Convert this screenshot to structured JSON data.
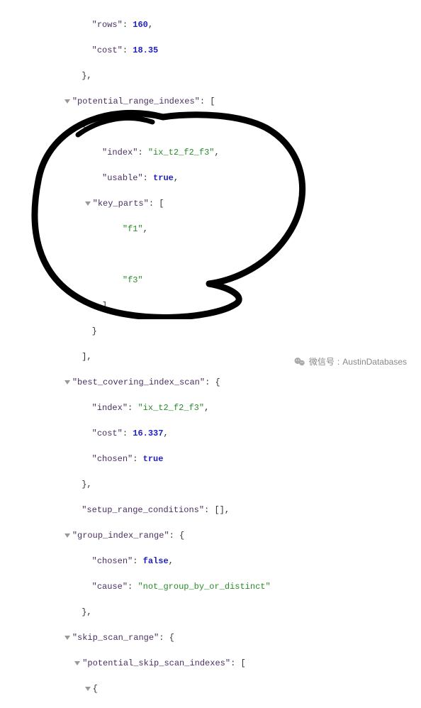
{
  "lines": {
    "rows_key": "\"rows\"",
    "rows_val": "160",
    "cost_key": "\"cost\"",
    "cost_val": "18.35",
    "pri_key": "\"potential_range_indexes\"",
    "index_key": "\"index\"",
    "index_val": "\"ix_t2_f2_f3\"",
    "usable_key": "\"usable\"",
    "usable_val": "true",
    "keyparts_key": "\"key_parts\"",
    "kp1": "\"f1\"",
    "kp2": "\"f3\"",
    "bcis_key": "\"best_covering_index_scan\"",
    "bcis_index_val": "\"ix_t2_f2_f3\"",
    "bcis_cost_val": "16.337",
    "chosen_key": "\"chosen\"",
    "chosen_true": "true",
    "src_key": "\"setup_range_conditions\"",
    "gir_key": "\"group_index_range\"",
    "gir_chosen_val": "false",
    "cause_key": "\"cause\"",
    "cause_val": "\"not_group_by_or_distinct\"",
    "ssr_key": "\"skip_scan_range\"",
    "pssi_key": "\"potential_skip_scan_indexes\""
  },
  "watermark": {
    "label": "微信号",
    "value": "AustinDatabases"
  }
}
